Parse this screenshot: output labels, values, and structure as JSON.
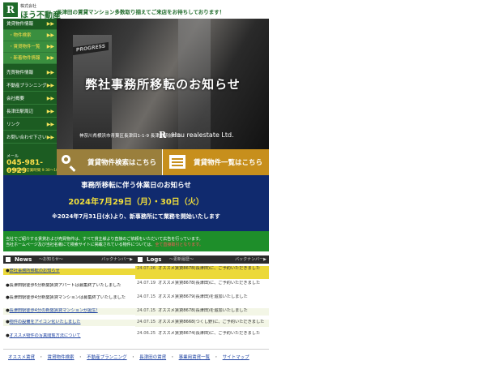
{
  "header": {
    "logo_mark": "R",
    "logo_small": "株式会社",
    "logo_name": "ほう不動産",
    "tagline": "長津田の賃貸マンション多数取り揃えてご来店をお待ちしております！"
  },
  "sidebar": {
    "items": [
      {
        "label": "賃貸物件情報",
        "sub": false
      },
      {
        "label": "・物件検索",
        "sub": true
      },
      {
        "label": "・賃貸物件一覧",
        "sub": true
      },
      {
        "label": "・新着物件情報",
        "sub": true
      },
      {
        "label": "売買物件情報",
        "sub": false
      },
      {
        "label": "不動産プランニング",
        "sub": false
      },
      {
        "label": "会社概要",
        "sub": false
      },
      {
        "label": "長津田駅周辺",
        "sub": false
      },
      {
        "label": "リンク",
        "sub": false
      },
      {
        "label": "お問い合わせ下さい",
        "sub": false
      }
    ],
    "arrow": "▶▶",
    "contact_label": "メール",
    "phone": "045-981-0929",
    "hours": "(年中無休・営業時間 9:30〜18:00)"
  },
  "hero": {
    "sign": "PROGRESS",
    "title": "弊社事務所移転のお知らせ",
    "address": "神奈川県横浜市青葉区長津田1-1-9 長津田駅前ビル",
    "r_mark": "R",
    "company": "Hou realestate Ltd."
  },
  "search_buttons": {
    "search_label": "賃貸物件検索はこちら",
    "list_label": "賃貸物件一覧はこちら"
  },
  "notice": {
    "title": "事務所移転に伴う休業日のお知らせ",
    "dates": "2024年7月29日（月）・30日（火）",
    "body": "※2024年7月31日(水)より、新事務所にて業務を開始いたします"
  },
  "info": {
    "line1": "当社でご紹介する賃貸および売買物件は、すべて貸主様より直接のご依頼をいただいて広告を行っています。",
    "line2": "当社ホームページ及び当社名義にて検索サイトに掲載されている物件については、",
    "line2_red": "全て直接取引となります。"
  },
  "news": {
    "title": "News",
    "sub": "〜お知らせ〜",
    "back": "バックナンバー▶",
    "items": [
      "弊社事務所移転のお知らせ",
      "長津田駅徒歩5分新築賃貸アパートは募集終了いたしました",
      "長津田駅徒歩4分新築賃貸マンションは募集終了いたしました",
      "長津田駅徒歩4分の新築賃貸マンションが誕生!",
      "物件の設備をアイコン化いたしました",
      "オススメ物件の写真閲覧方法について"
    ]
  },
  "logs": {
    "title": "Logs",
    "sub": "〜更新履歴〜",
    "back": "バックナンバー▶",
    "items": [
      {
        "date": "24.07.26",
        "text": "オススメ賃貸8678(長津田)に、ご予約いただきました"
      },
      {
        "date": "24.07.19",
        "text": "オススメ賃貸8678(長津田)に、ご予約いただきました"
      },
      {
        "date": "24.07.15",
        "text": "オススメ賃貸8679(長津田)を追加いたしました"
      },
      {
        "date": "24.07.15",
        "text": "オススメ賃貸8678(長津田)を追加いたしました"
      },
      {
        "date": "24.07.15",
        "text": "オススメ賃貸8668(つくし野)に、ご予約いただきました"
      },
      {
        "date": "24.06.25",
        "text": "オススメ賃貸8674(長津田)に、ご予約いただきました"
      }
    ]
  },
  "footer": {
    "links": [
      "オススメ賃貸",
      "賃貸物件検索",
      "不動産プランニング",
      "長津田の賃貸",
      "事業用賃貸一覧",
      "サイトマップ"
    ],
    "separator": "・"
  },
  "colors": {
    "brand_green": "#1c5c22",
    "notice_navy": "#102a6e",
    "accent_yellow": "#f2df3a"
  }
}
